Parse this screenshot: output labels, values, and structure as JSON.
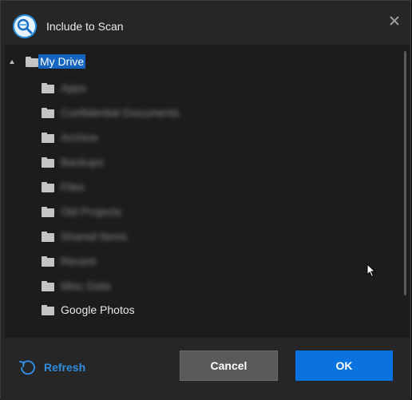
{
  "dialog": {
    "title": "Include to Scan",
    "app_icon": "search-scan-icon",
    "close_icon": "close-icon"
  },
  "tree": {
    "root": {
      "label": "My Drive",
      "selected": true,
      "expanded": true
    },
    "children": [
      {
        "label": "Apps",
        "blurred": true
      },
      {
        "label": "Confidential Documents",
        "blurred": true
      },
      {
        "label": "Archive",
        "blurred": true
      },
      {
        "label": "Backups",
        "blurred": true
      },
      {
        "label": "Files",
        "blurred": true
      },
      {
        "label": "Old Projects",
        "blurred": true
      },
      {
        "label": "Shared Items",
        "blurred": true
      },
      {
        "label": "Recent",
        "blurred": true
      },
      {
        "label": "Misc Data",
        "blurred": true
      },
      {
        "label": "Google Photos",
        "blurred": false
      }
    ]
  },
  "footer": {
    "refresh_label": "Refresh",
    "cancel_label": "Cancel",
    "ok_label": "OK"
  },
  "colors": {
    "accent": "#0a73e0",
    "selection": "#1565c0",
    "link": "#2f8ce0"
  }
}
